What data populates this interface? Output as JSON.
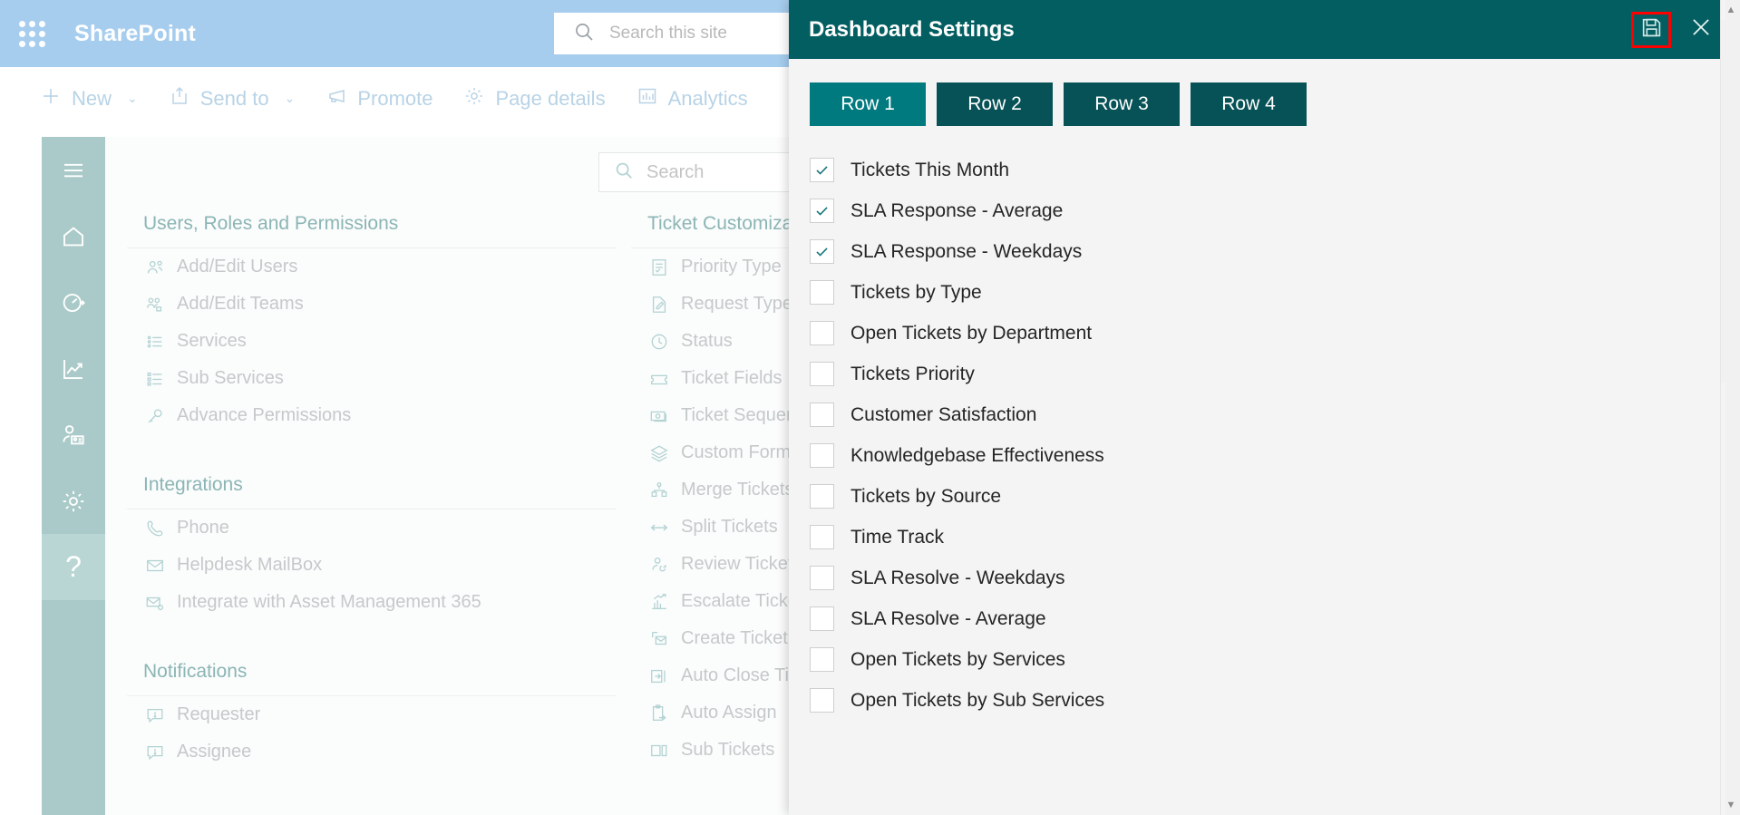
{
  "suite": {
    "waffle_icon": "app-launcher-icon",
    "brand": "SharePoint",
    "search_placeholder": "Search this site",
    "search_value": "",
    "search_icon": "search-icon"
  },
  "command_bar": {
    "items": [
      {
        "label": "New",
        "icon": "plus-icon",
        "has_chevron": true
      },
      {
        "label": "Send to",
        "icon": "share-icon",
        "has_chevron": true
      },
      {
        "label": "Promote",
        "icon": "megaphone-icon",
        "has_chevron": false
      },
      {
        "label": "Page details",
        "icon": "gear-icon",
        "has_chevron": false
      },
      {
        "label": "Analytics",
        "icon": "bar-chart-icon",
        "has_chevron": false
      }
    ]
  },
  "left_rail": {
    "items": [
      {
        "name": "menu-icon",
        "active": false
      },
      {
        "name": "home-icon",
        "active": false
      },
      {
        "name": "gauge-icon",
        "active": false
      },
      {
        "name": "trend-chart-icon",
        "active": false
      },
      {
        "name": "user-card-icon",
        "active": false
      },
      {
        "name": "gear-icon",
        "active": false
      },
      {
        "name": "help-icon",
        "active": true
      }
    ]
  },
  "content": {
    "search": {
      "placeholder": "Search",
      "value": "",
      "icon": "search-icon"
    },
    "columns": [
      {
        "sections": [
          {
            "title": "Users, Roles and Permissions",
            "items": [
              {
                "label": "Add/Edit Users",
                "icon": "users-icon"
              },
              {
                "label": "Add/Edit Teams",
                "icon": "team-icon"
              },
              {
                "label": "Services",
                "icon": "list-icon"
              },
              {
                "label": "Sub Services",
                "icon": "sub-list-icon"
              },
              {
                "label": "Advance Permissions",
                "icon": "key-icon"
              }
            ]
          },
          {
            "title": "Integrations",
            "items": [
              {
                "label": "Phone",
                "icon": "phone-icon"
              },
              {
                "label": "Helpdesk MailBox",
                "icon": "mail-icon"
              },
              {
                "label": "Integrate with Asset Management 365",
                "icon": "mail-gear-icon"
              }
            ]
          },
          {
            "title": "Notifications",
            "items": [
              {
                "label": "Requester",
                "icon": "comment-alert-icon"
              },
              {
                "label": "Assignee",
                "icon": "comment-alert-icon"
              }
            ]
          }
        ]
      },
      {
        "sections": [
          {
            "title": "Ticket Customization",
            "items": [
              {
                "label": "Priority Type",
                "icon": "checklist-icon"
              },
              {
                "label": "Request Type",
                "icon": "edit-doc-icon"
              },
              {
                "label": "Status",
                "icon": "clock-icon"
              },
              {
                "label": "Ticket Fields",
                "icon": "ticket-icon"
              },
              {
                "label": "Ticket Sequence",
                "icon": "money-icon"
              },
              {
                "label": "Custom Forms",
                "icon": "layers-icon"
              },
              {
                "label": "Merge Tickets",
                "icon": "merge-icon"
              },
              {
                "label": "Split Tickets",
                "icon": "split-icon"
              },
              {
                "label": "Review Tickets",
                "icon": "review-user-icon"
              },
              {
                "label": "Escalate Tickets",
                "icon": "escalate-chart-icon"
              },
              {
                "label": "Create Ticket",
                "icon": "create-mail-icon"
              },
              {
                "label": "Auto Close Tickets",
                "icon": "auto-close-icon"
              },
              {
                "label": "Auto Assign",
                "icon": "clipboard-arrow-icon"
              },
              {
                "label": "Sub Tickets",
                "icon": "sub-ticket-icon"
              }
            ]
          }
        ]
      }
    ]
  },
  "dialog": {
    "title": "Dashboard Settings",
    "save_icon": "save-icon",
    "close_icon": "close-icon",
    "save_highlight_color": "#fe0000",
    "header_color": "#035e62",
    "tab_active_color": "#00797f",
    "tab_inactive_color": "#075256",
    "tabs": [
      {
        "label": "Row 1",
        "active": true
      },
      {
        "label": "Row 2",
        "active": false
      },
      {
        "label": "Row 3",
        "active": false
      },
      {
        "label": "Row 4",
        "active": false
      }
    ],
    "checkboxes": [
      {
        "label": "Tickets This Month",
        "checked": true
      },
      {
        "label": "SLA Response - Average",
        "checked": true
      },
      {
        "label": "SLA Response - Weekdays",
        "checked": true
      },
      {
        "label": "Tickets by Type",
        "checked": false
      },
      {
        "label": "Open Tickets by Department",
        "checked": false
      },
      {
        "label": "Tickets Priority",
        "checked": false
      },
      {
        "label": "Customer Satisfaction",
        "checked": false
      },
      {
        "label": "Knowledgebase Effectiveness",
        "checked": false
      },
      {
        "label": "Tickets by Source",
        "checked": false
      },
      {
        "label": "Time Track",
        "checked": false
      },
      {
        "label": "SLA Resolve - Weekdays",
        "checked": false
      },
      {
        "label": "SLA Resolve - Average",
        "checked": false
      },
      {
        "label": "Open Tickets by Services",
        "checked": false
      },
      {
        "label": "Open Tickets by Sub Services",
        "checked": false
      }
    ],
    "scrollbar": {
      "up_arrow": "▲",
      "down_arrow": "▼"
    }
  }
}
